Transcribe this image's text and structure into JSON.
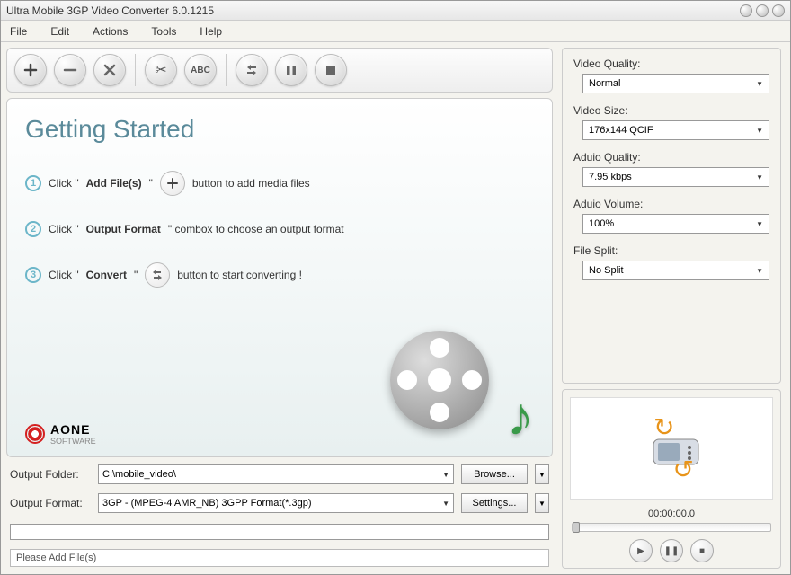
{
  "window": {
    "title": "Ultra Mobile 3GP Video Converter 6.0.1215"
  },
  "menu": {
    "file": "File",
    "edit": "Edit",
    "actions": "Actions",
    "tools": "Tools",
    "help": "Help"
  },
  "toolbar": {
    "abc": "ABC"
  },
  "getting_started": {
    "title": "Getting Started",
    "step1_a": "Click \"",
    "step1_b": "Add File(s)",
    "step1_c": "\"",
    "step1_d": "button to add media files",
    "step2_a": "Click \"",
    "step2_b": "Output Format",
    "step2_c": "\" combox to choose an output format",
    "step3_a": "Click \"",
    "step3_b": "Convert",
    "step3_c": "\"",
    "step3_d": "button to start converting !"
  },
  "brand": {
    "name": "AONE",
    "sub": "SOFTWARE"
  },
  "output": {
    "folder_label": "Output Folder:",
    "folder_value": "C:\\mobile_video\\",
    "format_label": "Output Format:",
    "format_value": "3GP - (MPEG-4 AMR_NB) 3GPP Format(*.3gp)",
    "browse": "Browse...",
    "settings": "Settings..."
  },
  "status": {
    "text": "Please Add File(s)"
  },
  "settings": {
    "video_quality": {
      "label": "Video Quality:",
      "value": "Normal"
    },
    "video_size": {
      "label": "Video Size:",
      "value": "176x144    QCIF"
    },
    "audio_quality": {
      "label": "Aduio Quality:",
      "value": "7.95  kbps"
    },
    "audio_volume": {
      "label": "Aduio Volume:",
      "value": "100%"
    },
    "file_split": {
      "label": "File Split:",
      "value": "No Split"
    }
  },
  "preview": {
    "time": "00:00:00.0"
  }
}
